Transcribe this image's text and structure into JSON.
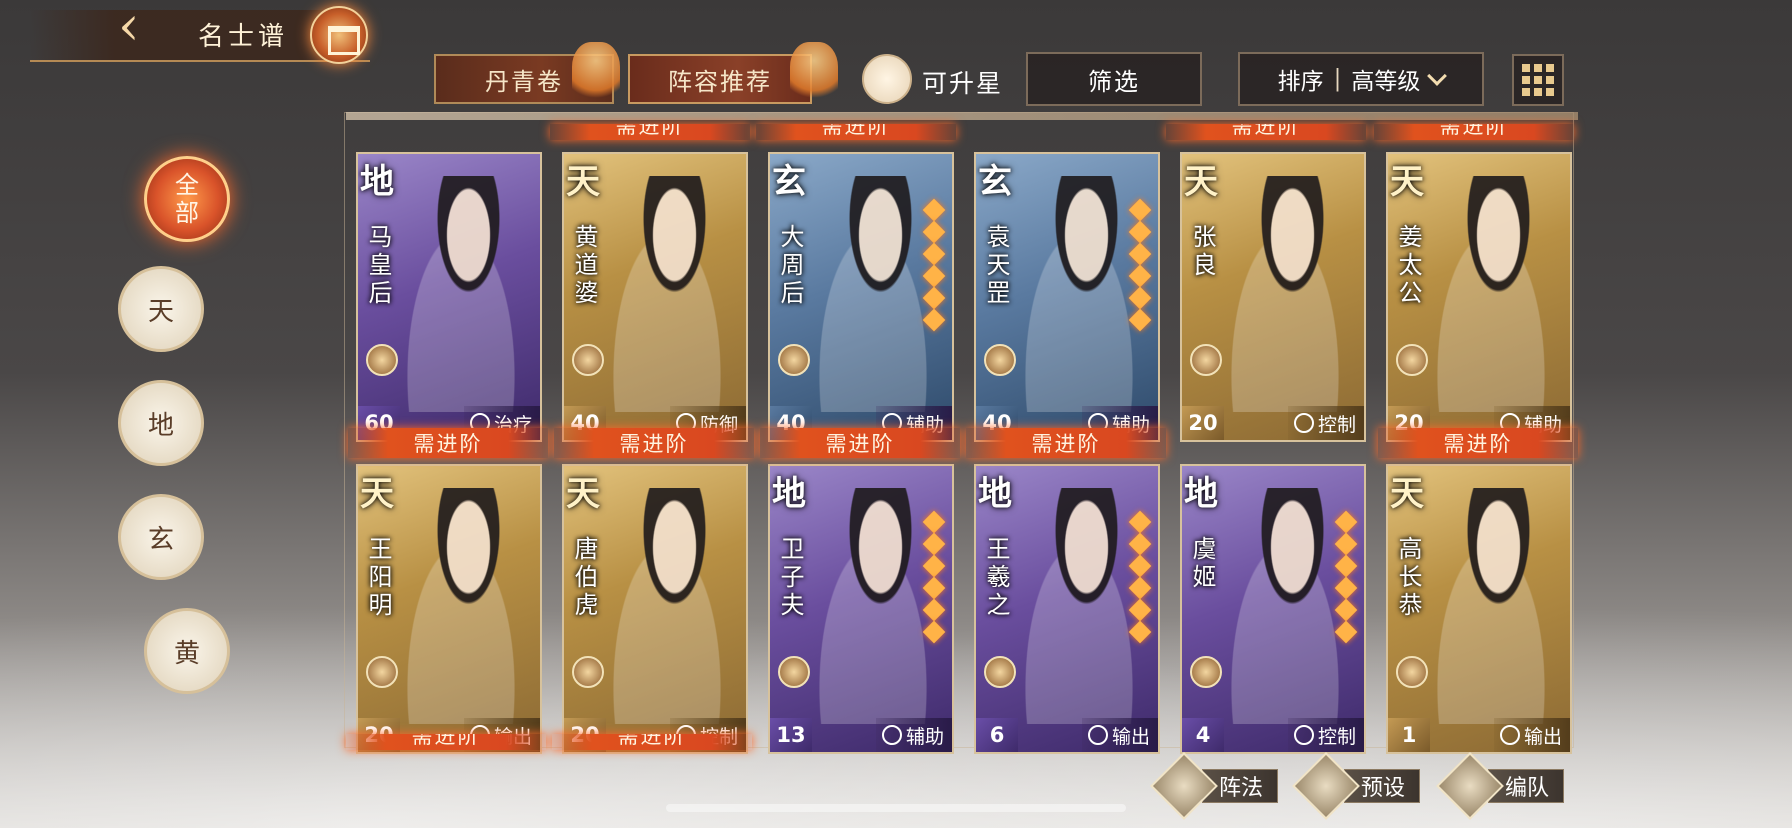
{
  "header": {
    "back_icon": "back-arrow-icon",
    "title": "名士谱"
  },
  "toolbar": {
    "tab_danqing": "丹青卷",
    "tab_lineup": "阵容推荐",
    "star_upgrade_label": "可升星",
    "filter_label": "筛选",
    "sort_label": "排序",
    "sort_sep": "|",
    "sort_value": "高等级"
  },
  "ranks": {
    "all": [
      "全",
      "部"
    ],
    "tian": "天",
    "di": "地",
    "xuan": "玄",
    "huang": "黄"
  },
  "advance_label": "需进阶",
  "cards": [
    {
      "rank": "地",
      "name": "马皇后",
      "level": "60",
      "role": "治疗",
      "tier": "di",
      "stars": 0
    },
    {
      "rank": "天",
      "name": "黄道婆",
      "level": "40",
      "role": "防御",
      "tier": "tian",
      "stars": 0
    },
    {
      "rank": "玄",
      "name": "大周后",
      "level": "40",
      "role": "辅助",
      "tier": "xuan",
      "stars": 6
    },
    {
      "rank": "玄",
      "name": "袁天罡",
      "level": "40",
      "role": "辅助",
      "tier": "xuan",
      "stars": 6
    },
    {
      "rank": "天",
      "name": "张良",
      "level": "20",
      "role": "控制",
      "tier": "tian",
      "stars": 0
    },
    {
      "rank": "天",
      "name": "姜太公",
      "level": "20",
      "role": "辅助",
      "tier": "tian",
      "stars": 0
    },
    {
      "rank": "天",
      "name": "王阳明",
      "level": "20",
      "role": "输出",
      "tier": "tian",
      "stars": 0
    },
    {
      "rank": "天",
      "name": "唐伯虎",
      "level": "20",
      "role": "控制",
      "tier": "tian",
      "stars": 0
    },
    {
      "rank": "地",
      "name": "卫子夫",
      "level": "13",
      "role": "辅助",
      "tier": "di",
      "stars": 6
    },
    {
      "rank": "地",
      "name": "王羲之",
      "level": "6",
      "role": "输出",
      "tier": "di",
      "stars": 6
    },
    {
      "rank": "地",
      "name": "虞姬",
      "level": "4",
      "role": "控制",
      "tier": "di",
      "stars": 6
    },
    {
      "rank": "天",
      "name": "高长恭",
      "level": "1",
      "role": "输出",
      "tier": "tian",
      "stars": 0
    }
  ],
  "bottom": {
    "formation": "阵法",
    "preset": "预设",
    "team": "编队"
  }
}
